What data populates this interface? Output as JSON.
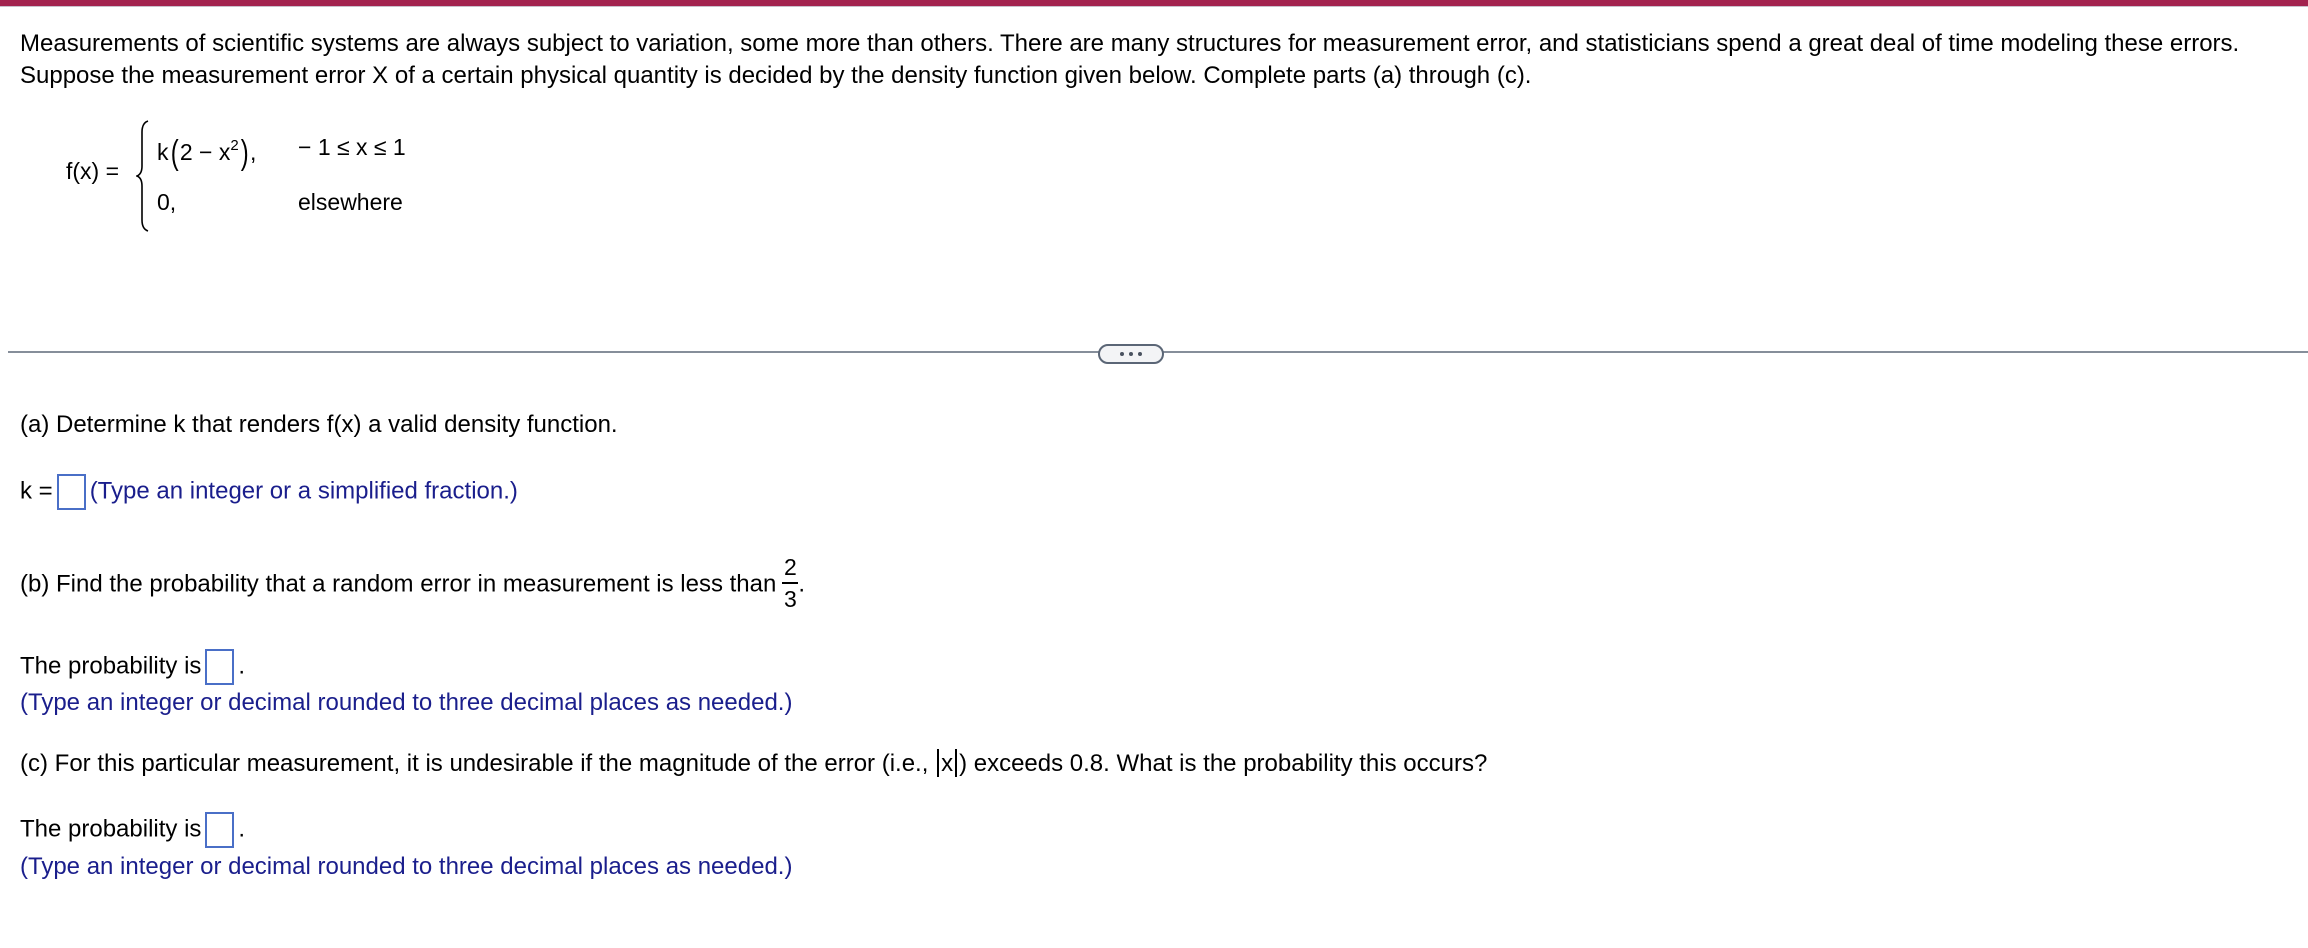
{
  "header": {
    "accent_color": "#A3234F"
  },
  "intro": {
    "text": "Measurements of scientific systems are always subject to variation, some more than others. There are many structures for measurement error, and statisticians spend a great deal of time modeling these errors. Suppose the measurement error X of a certain physical quantity is decided by the density function given below. Complete parts (a) through (c)."
  },
  "density": {
    "label": "f(x) =",
    "case1": {
      "coef": "k",
      "inner": "2 − x",
      "exponent": "2",
      "trail": ",",
      "condition": "− 1 ≤ x ≤ 1"
    },
    "case2": {
      "expr": "0,",
      "condition": "elsewhere"
    }
  },
  "divider": {
    "more_button_icon": "ellipsis-icon"
  },
  "part_a": {
    "question": "(a) Determine k that renders f(x) a valid density function.",
    "answer_label": "k =",
    "answer_value": "",
    "hint": "(Type an integer or a simplified fraction.)"
  },
  "part_b": {
    "question": "(b) Find the probability that a random error in measurement is less than",
    "fraction_num": "2",
    "fraction_den": "3",
    "question_end": ".",
    "answer_label": "The probability is",
    "answer_value": "",
    "answer_end": ".",
    "hint": "(Type an integer or decimal rounded to three decimal places as needed.)"
  },
  "part_c": {
    "question_start": "(c) For this particular measurement, it is undesirable if the magnitude of the error (i.e.,",
    "abs_var": "x",
    "question_end": ") exceeds 0.8. What is the probability this occurs?",
    "answer_label": "The probability is",
    "answer_value": "",
    "answer_end": ".",
    "hint": "(Type an integer or decimal rounded to three decimal places as needed.)"
  }
}
